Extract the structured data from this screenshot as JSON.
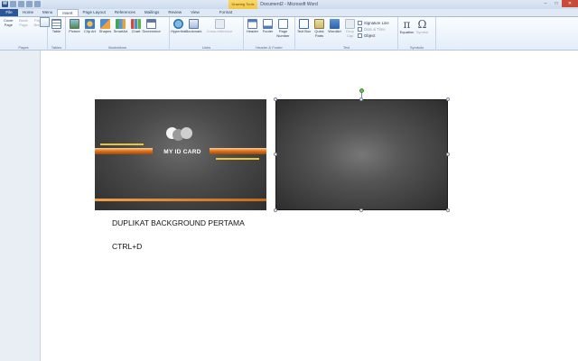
{
  "window": {
    "title": "Document2 - Microsoft Word",
    "context_tab": "Drawing Tools",
    "app_icon_letter": "W"
  },
  "tabs": [
    {
      "label": "File"
    },
    {
      "label": "Home"
    },
    {
      "label": "Menu"
    },
    {
      "label": "Insert"
    },
    {
      "label": "Page Layout"
    },
    {
      "label": "References"
    },
    {
      "label": "Mailings"
    },
    {
      "label": "Review"
    },
    {
      "label": "View"
    },
    {
      "label": "Format"
    }
  ],
  "ribbon": {
    "pages": {
      "label": "Pages",
      "cover": "Cover Page",
      "blank": "Blank Page",
      "break": "Page Break"
    },
    "tables": {
      "label": "Tables",
      "table": "Table"
    },
    "illustrations": {
      "label": "Illustrations",
      "picture": "Picture",
      "clipart": "Clip Art",
      "shapes": "Shapes",
      "smartart": "SmartArt",
      "chart": "Chart",
      "screenshot": "Screenshot"
    },
    "links": {
      "label": "Links",
      "hyperlink": "Hyperlink",
      "bookmark": "Bookmark",
      "crossref": "Cross-reference"
    },
    "headerfooter": {
      "label": "Header & Footer",
      "header": "Header",
      "footer": "Footer",
      "pagenum": "Page Number"
    },
    "text": {
      "label": "Text",
      "textbox": "Text Box",
      "quickparts": "Quick Parts",
      "wordart": "WordArt",
      "dropcap": "Drop Cap",
      "signature": "Signature Line",
      "datetime": "Date & Time",
      "object": "Object"
    },
    "symbols": {
      "label": "Symbols",
      "equation": "Equation",
      "symbol": "Symbol"
    }
  },
  "document": {
    "card_title": "MY ID CARD",
    "line1": "DUPLIKAT BACKGROUND PERTAMA",
    "line2": "CTRL+D"
  },
  "colors": {
    "file_tab": "#2a5699",
    "orange_stripe": "#e0761f",
    "rotate_handle": "#6ec04a"
  }
}
